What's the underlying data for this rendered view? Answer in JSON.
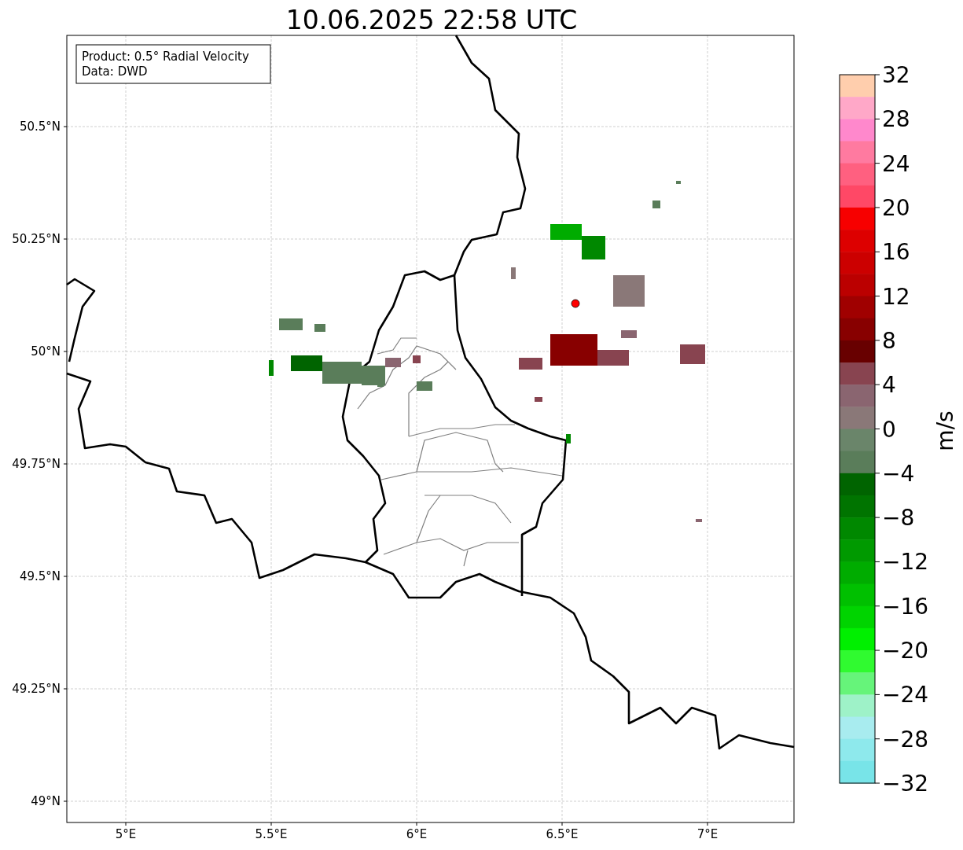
{
  "title": "10.06.2025 22:58 UTC",
  "legend": {
    "lines": [
      "Product: 0.5° Radial Velocity",
      "Data: DWD"
    ]
  },
  "map": {
    "lat_ticks": [
      "50.5°N",
      "50.25°N",
      "50°N",
      "49.75°N",
      "49.5°N",
      "49.25°N",
      "49°N"
    ],
    "lon_ticks": [
      "5°E",
      "5.5°E",
      "6°E",
      "6.5°E",
      "7°E"
    ]
  },
  "colorbar": {
    "label": "m/s",
    "segments": [
      {
        "color": "#ffcead"
      },
      {
        "color": "#ffa8c8"
      },
      {
        "color": "#ff88cc"
      },
      {
        "color": "#ff7aa0"
      },
      {
        "color": "#ff6080"
      },
      {
        "color": "#ff4866"
      },
      {
        "color": "#f70000"
      },
      {
        "color": "#dd0000"
      },
      {
        "color": "#cc0000"
      },
      {
        "color": "#bb0000"
      },
      {
        "color": "#a00000"
      },
      {
        "color": "#880000"
      },
      {
        "color": "#680000"
      },
      {
        "color": "#884450"
      },
      {
        "color": "#8a6570"
      },
      {
        "color": "#8a7878"
      },
      {
        "color": "#6a856a"
      },
      {
        "color": "#5a7d5a"
      },
      {
        "color": "#006400"
      },
      {
        "color": "#007400"
      },
      {
        "color": "#008800"
      },
      {
        "color": "#009a00"
      },
      {
        "color": "#00ac00"
      },
      {
        "color": "#00c000"
      },
      {
        "color": "#00d400"
      },
      {
        "color": "#00f000"
      },
      {
        "color": "#30fa30"
      },
      {
        "color": "#66f47a"
      },
      {
        "color": "#9ef2c8"
      },
      {
        "color": "#a8ecef"
      },
      {
        "color": "#8ee9ec"
      },
      {
        "color": "#78e4e8"
      }
    ],
    "ticks": [
      "32",
      "28",
      "24",
      "20",
      "16",
      "12",
      "8",
      "4",
      "0",
      "−4",
      "−8",
      "−12",
      "−16",
      "−20",
      "−24",
      "−28",
      "−32"
    ]
  }
}
